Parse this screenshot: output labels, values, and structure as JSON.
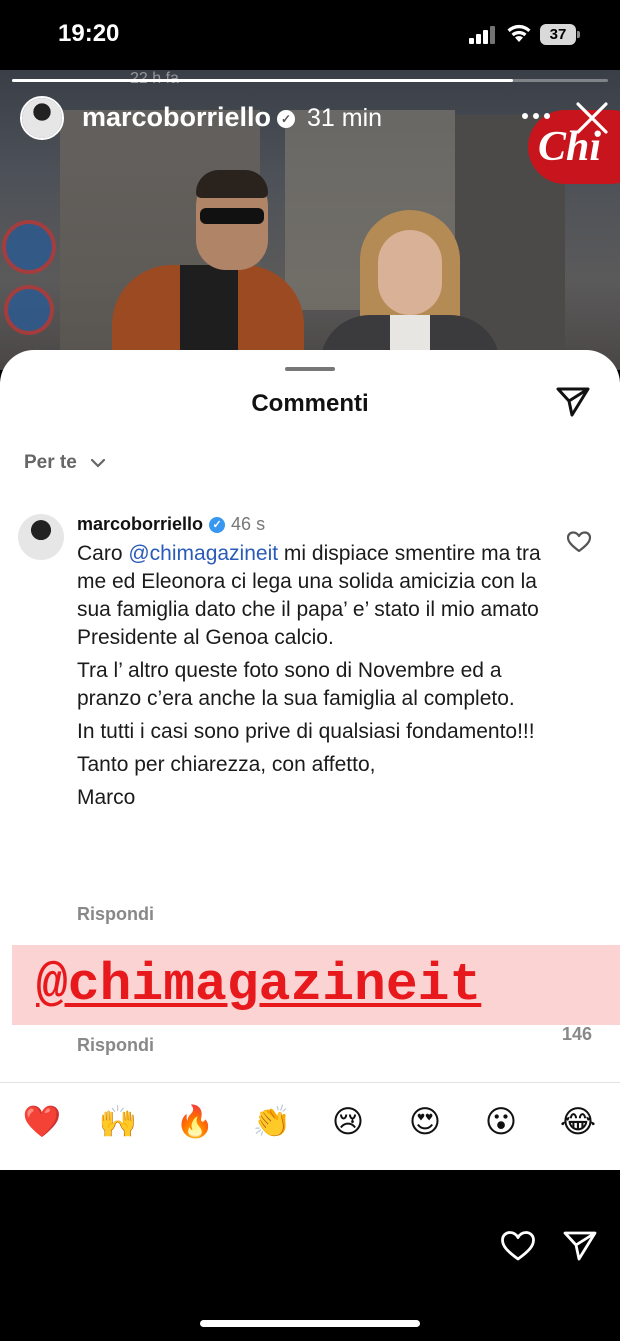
{
  "status_bar": {
    "time": "19:20",
    "battery": "37"
  },
  "story": {
    "ghost_time": "22 h fa",
    "username": "marcoborriello",
    "time": "31 min",
    "progress": 0.84,
    "photo_logo": "Chi"
  },
  "comments_sheet": {
    "title": "Commenti",
    "filter_label": "Per te",
    "comment": {
      "username": "marcoborriello",
      "time": "46 s",
      "paragraphs": [
        {
          "before": "Caro ",
          "mention": "@chimagazineit",
          "after": " mi dispiace smentire ma tra me ed Eleonora ci lega una solida amicizia con la sua famiglia dato che il papa’ e’ stato il mio amato Presidente al Genoa calcio."
        },
        {
          "text": "Tra l’ altro queste foto sono di Novembre ed a pranzo c’era anche la sua famiglia al completo."
        },
        {
          "text": "In tutti i casi sono prive di qualsiasi fondamento!!!"
        },
        {
          "text": "Tanto per chiarezza, con affetto,"
        },
        {
          "text": "Marco"
        }
      ],
      "reply_label": "Rispondi"
    },
    "overlay_tag": "@chimagazineit",
    "second_comment": {
      "likes": "146",
      "reply_label": "Rispondi"
    },
    "emoji_reactions": [
      "❤️",
      "🙌",
      "🔥",
      "👏",
      "😢",
      "😍",
      "😮",
      "😂"
    ]
  },
  "icons": [
    "signal-icon",
    "wifi-icon",
    "battery-icon",
    "verified-icon",
    "more-icon",
    "close-icon",
    "share-icon",
    "chevron-down-icon",
    "heart-icon",
    "send-icon"
  ]
}
